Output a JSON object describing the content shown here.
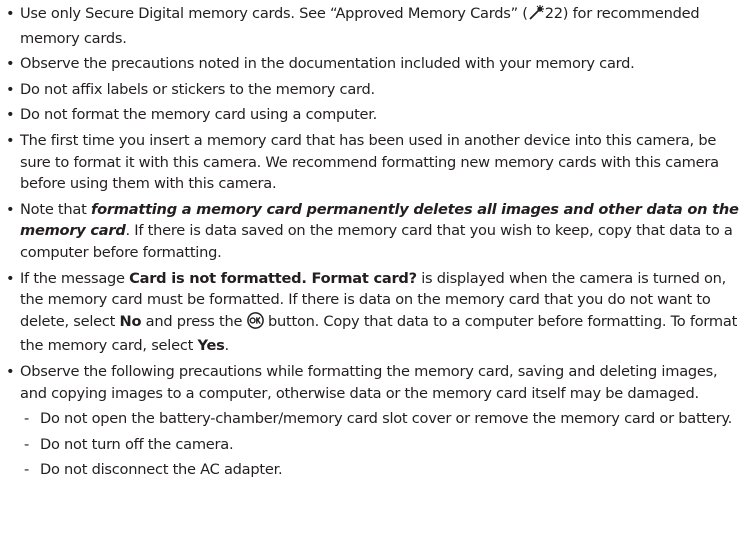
{
  "bullets": [
    {
      "parts": [
        "Use only Secure Digital memory cards. See “Approved Memory Cards” (",
        "22) for recommended memory cards."
      ]
    },
    {
      "text": "Observe the precautions noted in the documentation included with your memory card."
    },
    {
      "text": "Do not affix labels or stickers to the memory card."
    },
    {
      "text": "Do not format the memory card using a computer."
    },
    {
      "text": "The first time you insert a memory card that has been used in another device into this camera, be sure to format it with this camera. We recommend formatting new memory cards with this camera before using them with this camera."
    },
    {
      "parts": [
        "Note that ",
        "formatting a memory card permanently deletes all images and other data on the memory card",
        ". If there is data saved on the memory card that you wish to keep, copy that data to a computer before formatting."
      ]
    },
    {
      "parts": [
        "If the message ",
        "Card is not formatted. Format card?",
        " is displayed when the camera is turned on, the memory card must be formatted. If there is data on the memory card that you do not want to delete, select ",
        "No",
        " and press the ",
        " button. Copy that data to a computer before formatting. To format the memory card, select ",
        "Yes",
        "."
      ]
    },
    {
      "text": "Observe the following precautions while formatting the memory card, saving and deleting images, and copying images to a computer, otherwise data or the memory card itself may be damaged.",
      "sub_items": [
        "Do not open the battery-chamber/memory card slot cover or remove the memory card or battery.",
        "Do not turn off the camera.",
        "Do not disconnect the AC adapter."
      ]
    }
  ],
  "bullet_glyph": "•",
  "dash_glyph": "-",
  "icons": {
    "reference": "tip-reference-icon",
    "ok": "ok-button-icon"
  }
}
